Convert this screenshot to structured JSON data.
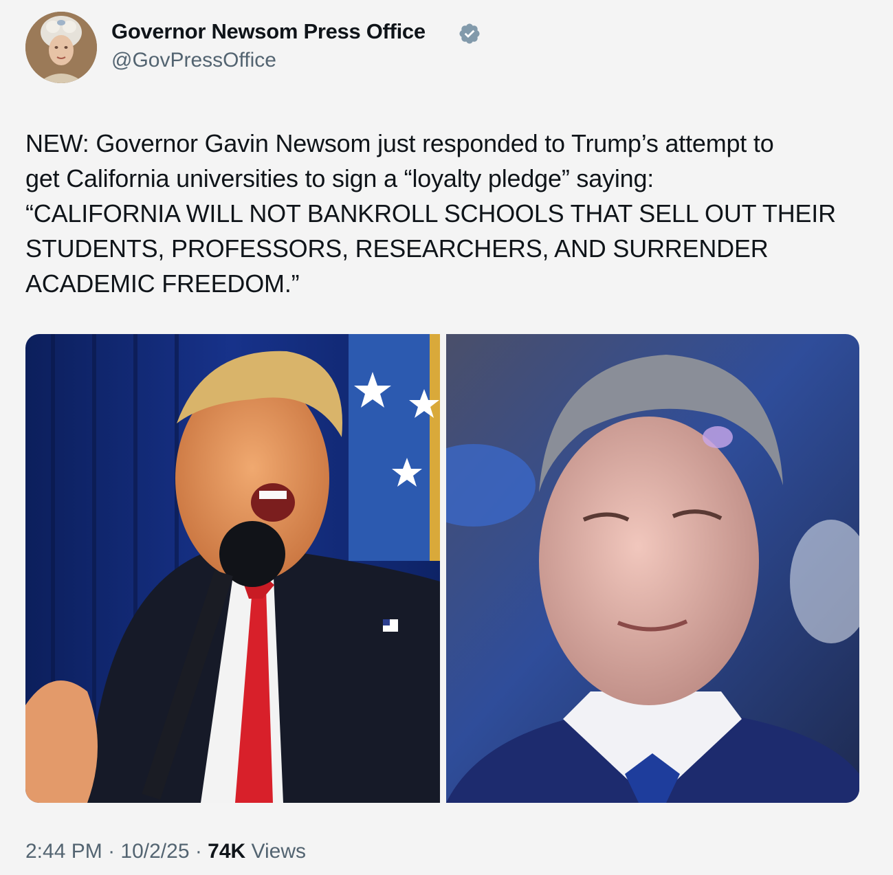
{
  "author": {
    "display_name": "Governor Newsom Press Office",
    "handle": "@GovPressOffice",
    "verified": true,
    "verified_color": "#829aab"
  },
  "tweet": {
    "lines": [
      "NEW: Governor Gavin Newsom just responded to Trump’s attempt to",
      "get California universities to sign a “loyalty pledge” saying:",
      "“CALIFORNIA WILL NOT BANKROLL SCHOOLS THAT SELL OUT THEIR",
      "STUDENTS, PROFESSORS, RESEARCHERS, AND SURRENDER",
      "ACADEMIC FREEDOM.”"
    ]
  },
  "media": {
    "left_photo": "Trump speaking at microphone",
    "right_photo": "Newsom portrait"
  },
  "meta": {
    "time": "2:44 PM",
    "separator": " · ",
    "date": "10/2/25",
    "views_count": "74K",
    "views_label": " Views"
  }
}
